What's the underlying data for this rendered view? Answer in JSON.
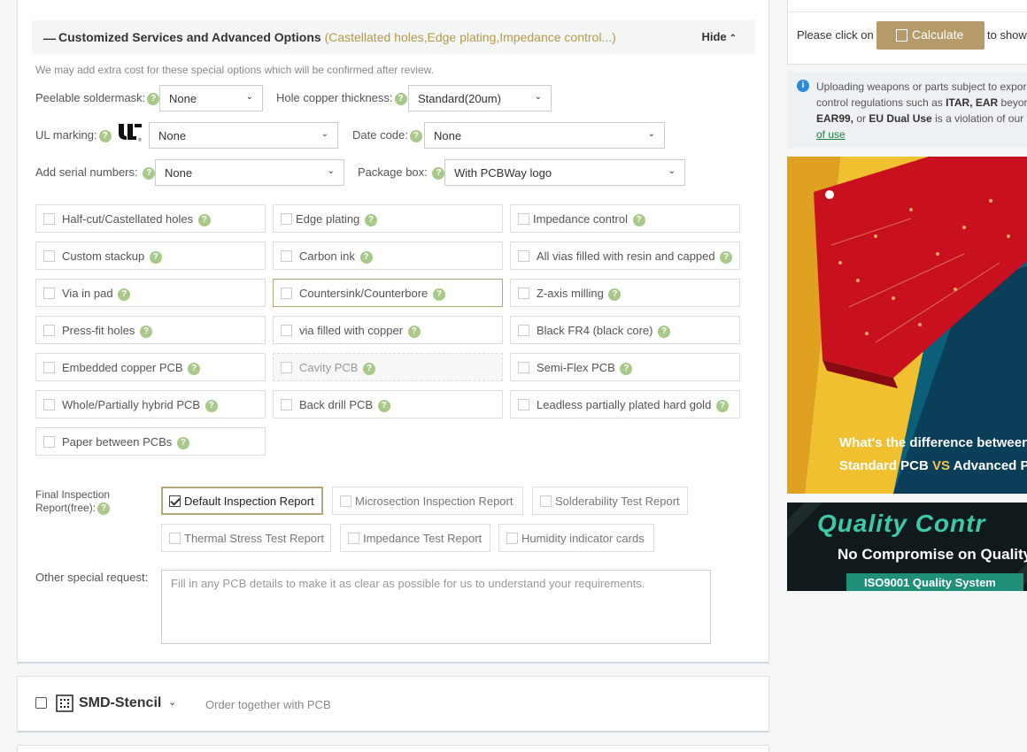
{
  "section": {
    "dash": "—",
    "title": "Customized Services and Advanced Options",
    "subtitle": "(Castellated holes,Edge plating,Impedance control...)",
    "hide_label": "Hide",
    "note": "We may add extra cost for these special options which will be confirmed after review."
  },
  "help_glyph": "?",
  "dropdowns": {
    "peelable": {
      "label": "Peelable soldermask:",
      "value": "None"
    },
    "hole_copper": {
      "label": "Hole copper thickness:",
      "value": "Standard(20um)"
    },
    "ul_marking": {
      "label": "UL marking:",
      "value": "None"
    },
    "date_code": {
      "label": "Date code:",
      "value": "None"
    },
    "serial": {
      "label": "Add serial numbers:",
      "value": "None"
    },
    "package": {
      "label": "Package box:",
      "value": "With PCBWay logo"
    }
  },
  "options": [
    "Half-cut/Castellated holes",
    "Edge plating",
    "Impedance control",
    "Custom stackup",
    "Carbon ink",
    "All vias filled with resin and capped",
    "Via in pad",
    "Countersink/Counterbore",
    "Z-axis milling",
    "Press-fit holes",
    "via filled with copper",
    "Black FR4 (black core)",
    "Embedded copper PCB",
    "Cavity PCB",
    "Semi-Flex PCB",
    "Whole/Partially hybrid PCB",
    "Back drill PCB",
    "Leadless partially plated hard gold",
    "Paper between PCBs"
  ],
  "inspection": {
    "label_line1": "Final Inspection",
    "label_line2": "Report(free):",
    "items": [
      {
        "label": "Default Inspection Report",
        "checked": true
      },
      {
        "label": "Microsection Inspection Report",
        "checked": false
      },
      {
        "label": "Solderability Test Report",
        "checked": false
      },
      {
        "label": "Thermal Stress Test Report",
        "checked": false
      },
      {
        "label": "Impedance Test Report",
        "checked": false
      },
      {
        "label": "Humidity indicator cards",
        "checked": false
      }
    ]
  },
  "other": {
    "label": "Other special request:",
    "placeholder": "Fill in any PCB details to make it as clear as possible for us to understand your requirements."
  },
  "stencil": {
    "name": "SMD-Stencil",
    "subtitle": "Order together with PCB"
  },
  "sidebar": {
    "calc_prefix": "Please click on",
    "calc_button": "Calculate",
    "calc_suffix": "to show",
    "notice_line1": "Uploading weapons or parts subject to expor",
    "notice_line2_pre": "control regulations such as ",
    "notice_itar": "ITAR, EAR",
    "notice_line2_post": " beyor",
    "notice_ear99": "EAR99,",
    "notice_or": " or ",
    "notice_dual": "EU Dual Use",
    "notice_line3_post": " is a violation of our",
    "notice_link": "of use",
    "banner1_line1": "What's the difference between",
    "banner1_std": "Standard PCB ",
    "banner1_vs": "VS",
    "banner1_adv": " Advanced P",
    "banner2_title": "Quality Contr",
    "banner2_sub": "No Compromise on Quality",
    "banner2_iso": "ISO9001 Quality System"
  },
  "colors": {
    "accent_gold": "#b69a4a",
    "help_green": "#a9c98a",
    "calc_button": "#b69a6a",
    "info_blue": "#2d8ad6"
  }
}
